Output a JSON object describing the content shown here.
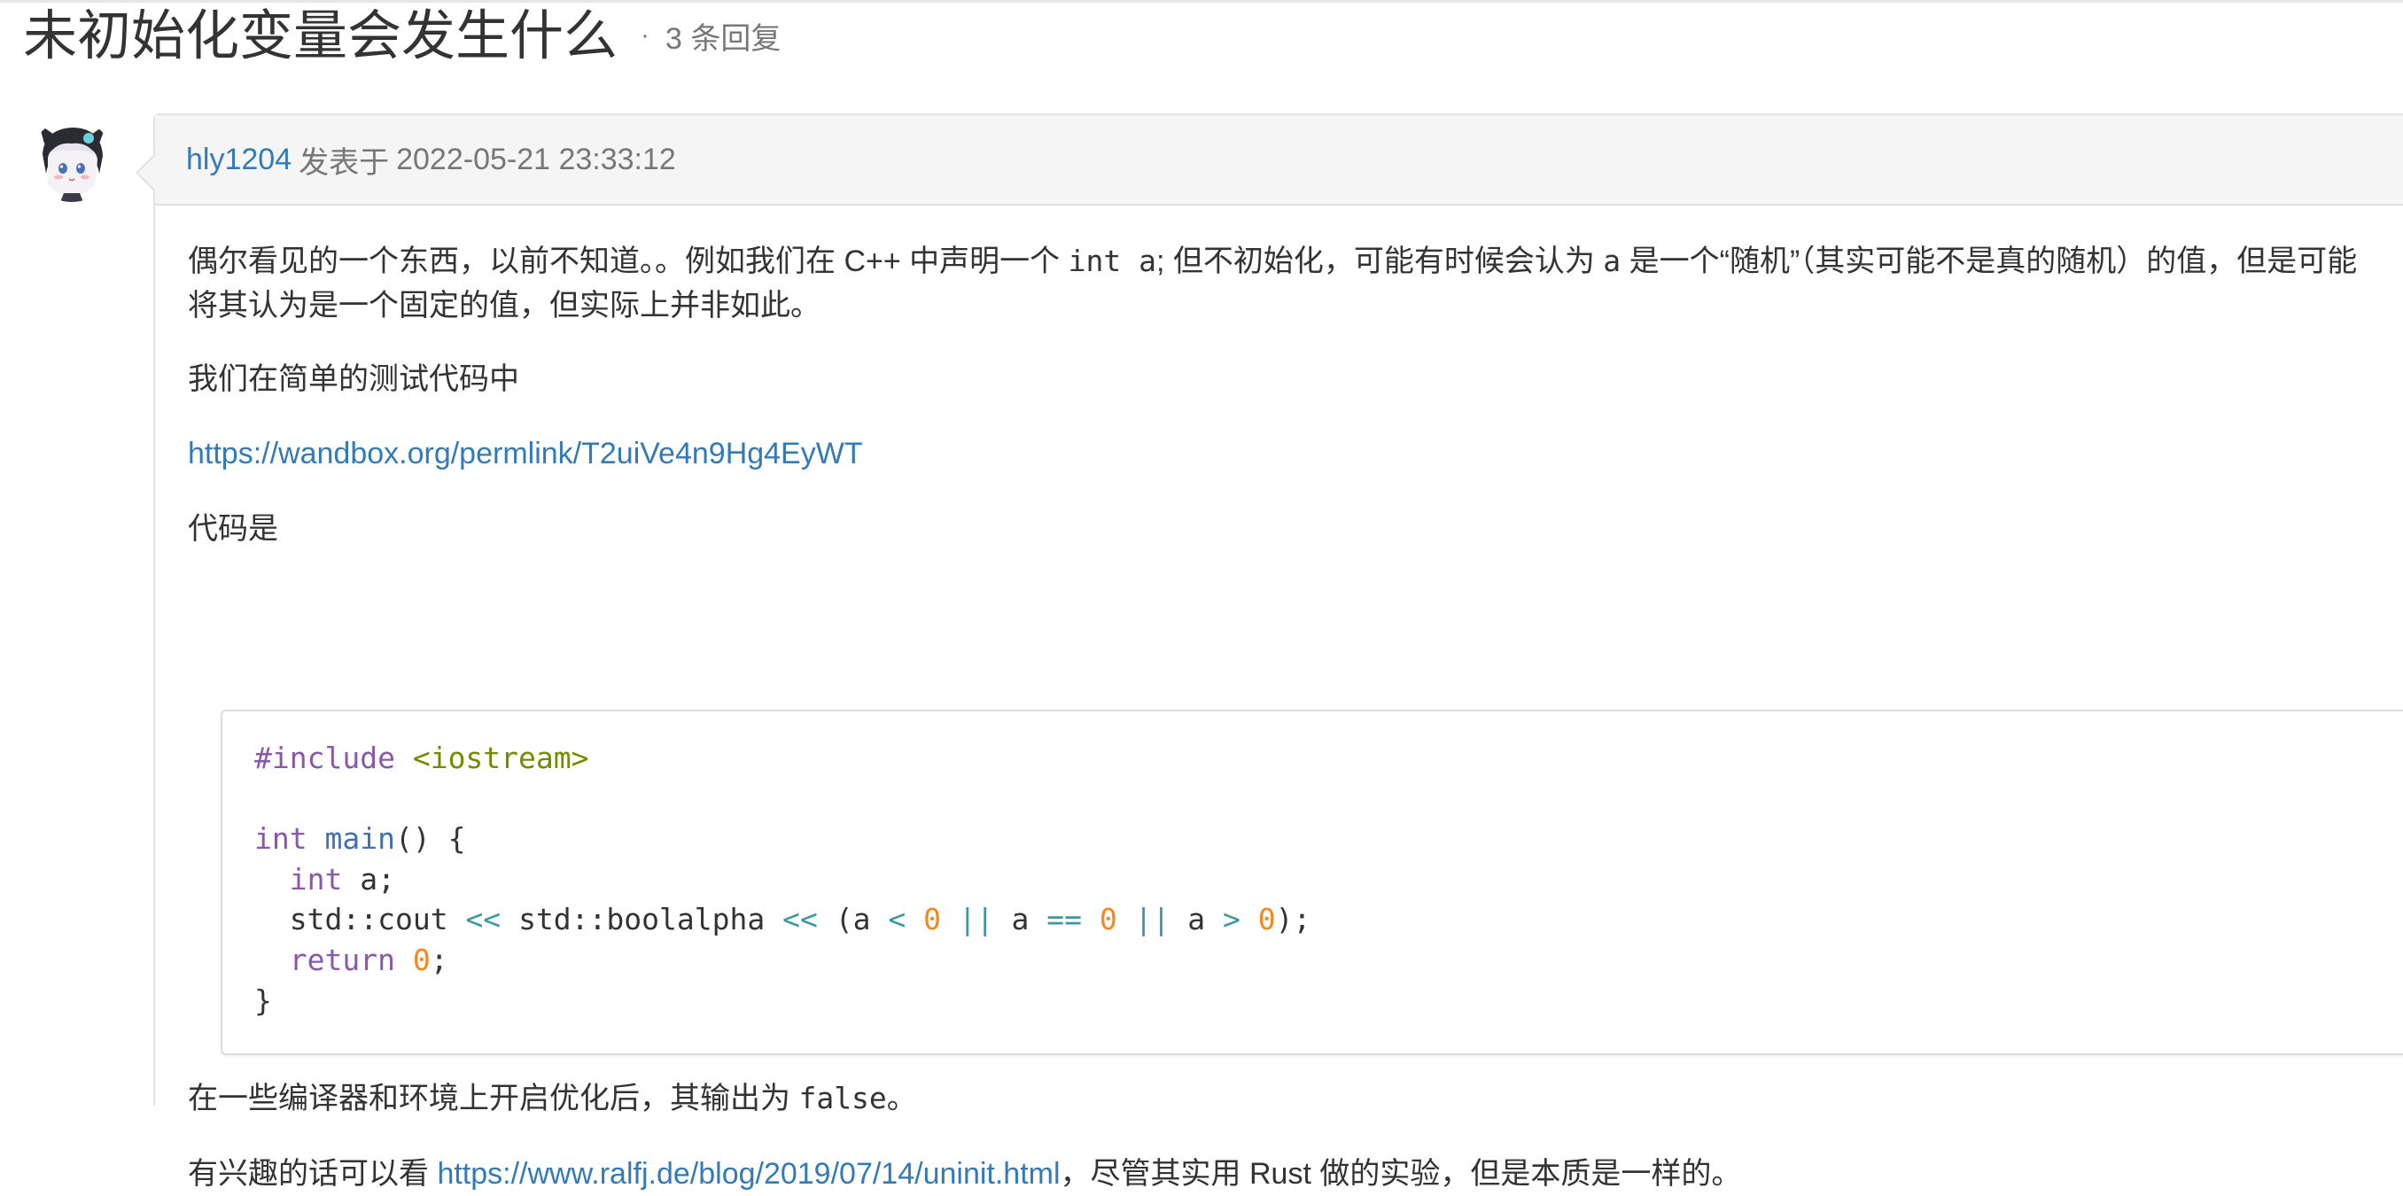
{
  "topic": {
    "title": "未初始化变量会发生什么",
    "separator": "·",
    "reply_count": "3 条回复"
  },
  "post": {
    "author": "hly1204",
    "posted_label": "发表于",
    "timestamp": "2022-05-21 23:33:12",
    "para1": {
      "text_a": "偶尔看见的一个东西，以前不知道。。例如我们在 C++ 中声明一个 ",
      "code_a": "int a",
      "text_b": "; 但不初始化，可能有时候会认为 ",
      "code_b": "a",
      "text_c": " 是一个“随机”（其实可能不是真的随机）的值，但是可能将其认为是一个固定的值，但实际上并非如此。"
    },
    "para2": "我们在简单的测试代码中",
    "link1": "https://wandbox.org/permlink/T2uiVe4n9Hg4EyWT",
    "para4": "代码是",
    "code_block": {
      "include_directive": "#include",
      "include_header": "<iostream>",
      "kw_int": "int",
      "fn_main": "main",
      "main_tail": "() {",
      "indent": "  ",
      "var_a": " a;",
      "std_cout": "std::cout",
      "op_shift": "<<",
      "std_boolalpha": "std::boolalpha",
      "open_paren": "(",
      "var": "a",
      "op_lt": "<",
      "op_or": "||",
      "op_eq": "==",
      "op_gt": ">",
      "zero": "0",
      "close_stmt": ");",
      "kw_return": "return",
      "semicolon": ";",
      "close_brace": "}"
    },
    "para5": {
      "text_a": "在一些编译器和环境上开启优化后，其输出为 ",
      "code": "false",
      "text_b": "。"
    },
    "para6": {
      "text_a": "有兴趣的话可以看 ",
      "link": "https://www.ralfj.de/blog/2019/07/14/uninit.html",
      "text_b": "，尽管其实用 Rust 做的实验，但是本质是一样的。"
    }
  },
  "colors": {
    "link": "#337ab7",
    "muted": "#777777",
    "header_bg": "#f5f5f5",
    "code_keyword": "#8959a8",
    "code_string": "#718c00",
    "code_function": "#4271ae",
    "code_number": "#f5871f",
    "code_operator": "#3e999f"
  }
}
